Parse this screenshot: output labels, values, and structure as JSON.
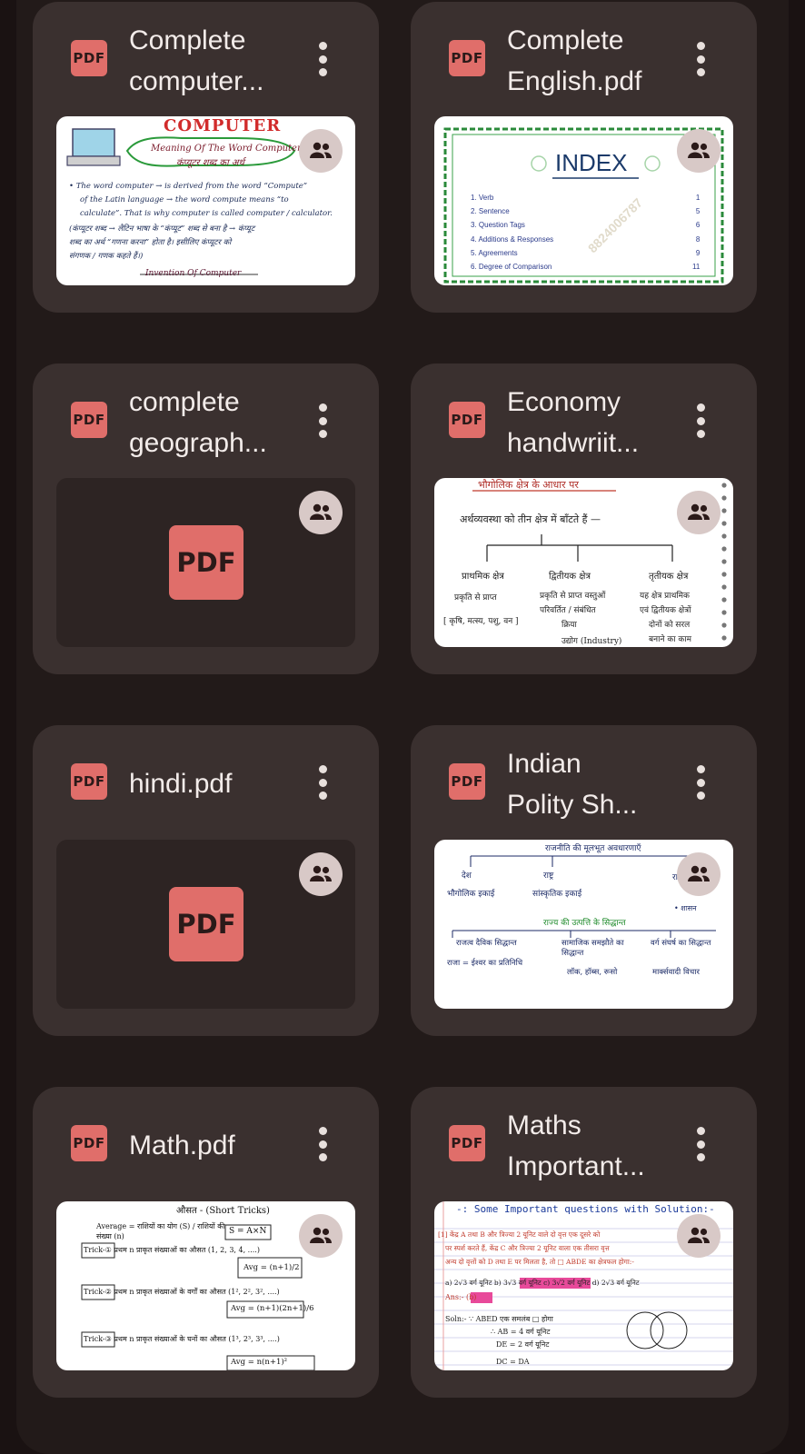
{
  "files": [
    {
      "title": "Complete\ncomputer...",
      "badge": "PDF",
      "thumb": "computer",
      "shared": true
    },
    {
      "title": "Complete\nEnglish.pdf",
      "badge": "PDF",
      "thumb": "english",
      "shared": true
    },
    {
      "title": "complete\ngeograph...",
      "badge": "PDF",
      "thumb": "placeholder",
      "shared": true
    },
    {
      "title": "Economy\nhandwriit...",
      "badge": "PDF",
      "thumb": "economy",
      "shared": true
    },
    {
      "title": "hindi.pdf",
      "badge": "PDF",
      "thumb": "placeholder",
      "shared": true
    },
    {
      "title": "Indian\nPolity Sh...",
      "badge": "PDF",
      "thumb": "polity",
      "shared": true
    },
    {
      "title": "Math.pdf",
      "badge": "PDF",
      "thumb": "math",
      "shared": true
    },
    {
      "title": "Maths\nImportant...",
      "badge": "PDF",
      "thumb": "maths2",
      "shared": true
    }
  ],
  "placeholder_label": "PDF",
  "thumb_text": {
    "computer": {
      "heading": "COMPUTER",
      "meaning": "Meaning Of The Word Computer",
      "hindi_title": "कंप्यूटर शब्द का अर्थ",
      "line1": "• The word computer → is derived from the word “Compute”",
      "line2": "of the Latin language → the word compute means “to",
      "line3": "calculate”. That is why computer is called computer / calculator.",
      "line4": "(कंप्यूटर शब्द → लैटिन भाषा के “कंप्यूट” शब्द से बना है → कंप्यूट",
      "line5": "शब्द का अर्थ “गणना करना” होता है। इसीलिए कंप्यूटर को",
      "line6": "संगणक / गणक कहते हैं।)",
      "footer": "Invention Of Computer"
    },
    "english": {
      "heading": "INDEX",
      "items": [
        "1. Verb",
        "2. Sentence",
        "3. Question Tags",
        "4. Additions & Responses",
        "5. Agreements",
        "6. Degree of Comparison"
      ],
      "pages": [
        "1",
        "5",
        "6",
        "8",
        "9",
        "11"
      ],
      "watermark": "8824006787"
    },
    "economy": {
      "heading": "भौगोलिक क्षेत्र के आधार पर",
      "intro": "अर्थव्यवस्था को तीन क्षेत्र में बाँटते हैं —",
      "col1": "प्राथमिक क्षेत्र",
      "col2": "द्वितीयक क्षेत्र",
      "col3": "तृतीयक क्षेत्र",
      "c1a": "प्रकृति से प्राप्त",
      "c1b": "[ कृषि, मत्स्य, पशु, वन ]",
      "c2a": "प्रकृति से प्राप्त वस्तुओं",
      "c2b": "परिवर्तित / संबंधित",
      "c2c": "क्रिया",
      "c2d": "उद्योग (Industry)",
      "c3a": "यह क्षेत्र प्राथमिक",
      "c3b": "एवं द्वितीयक क्षेत्रों",
      "c3c": "दोनों को सरल",
      "c3d": "बनाने का काम"
    },
    "polity": {
      "heading": "राजनीति की मूलभूत अवधारणाएँ",
      "a1": "देश",
      "a2": "राष्ट्र",
      "a3": "राज्य",
      "b1": "भौगोलिक इकाई",
      "b2": "सांस्कृतिक इकाई",
      "b3": "• शासन",
      "sub": "राज्य की उत्पत्ति के सिद्धान्त",
      "t1": "राजत्व दैविक सिद्धान्त",
      "t2": "सामाजिक समझौते का सिद्धान्त",
      "t3": "वर्ग संघर्ष का सिद्धान्त",
      "d1": "राजा = ईश्वर का प्रतिनिधि",
      "d2": "लॉक, हॉब्स, रूसो",
      "d3": "मार्क्सवादी विचार"
    },
    "math": {
      "heading": "औसत - (Short Tricks)",
      "formula": "Average = राशियों का योग (S) / राशियों की संख्या (n)",
      "box": "S = A×N",
      "trick1": "Trick-① प्रथम n प्राकृत संख्याओं का औसत (1, 2, 3, 4, ....)",
      "avg1": "Avg = (n+1)/2",
      "trick2": "Trick-② प्रथम n प्राकृत संख्याओं के वर्गों का औसत (1², 2², 3², ....)",
      "avg2": "Avg = (n+1)(2n+1)/6",
      "trick3": "Trick-③ प्रथम n प्राकृत संख्याओं के घनों का औसत (1³, 2³, 3³, ....)",
      "avg3": "Avg = n(n+1)²"
    },
    "maths2": {
      "heading": "-: Some Important questions with Solution:-",
      "q": "[1] केंद्र A तथा B और त्रिज्या 2 यूनिट वाले दो वृत्त एक दूसरे को",
      "q2": "पर स्पर्श करते हैं, केंद्र C और त्रिज्या 2 यूनिट वाला एक तीसरा वृत्त",
      "q3": "अन्य दो वृत्तों को D तथा E पर मिलता है, तो □ ABDE का क्षेत्रफल होगा:-",
      "opts": "a) 2√3 वर्ग यूनिट   b) 3√3 वर्ग यूनिट   c) 3√2 वर्ग यूनिट   d) 2√3 वर्ग यूनिट",
      "ans": "Ans:- (b)",
      "sol": "Soln:- ∵ ABED एक समलंब □ होगा",
      "s1": "∴ AB = 4 वर्ग यूनिट",
      "s2": "DE = 2 वर्ग यूनिट",
      "s3": "DC = DA"
    }
  },
  "colors": {
    "background": "#1a1212",
    "card": "#3a302f",
    "accent": "#e06e6a",
    "shared_badge": "#d8c9c7"
  }
}
